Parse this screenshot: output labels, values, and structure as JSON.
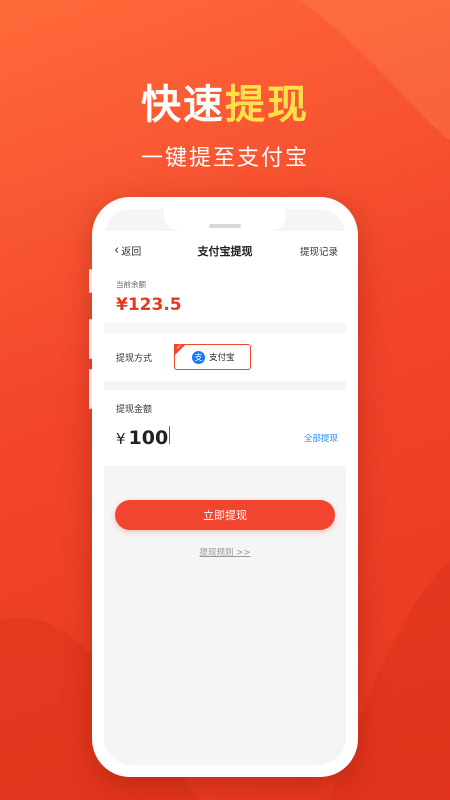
{
  "headline": {
    "part1": "快速",
    "part2": "提现"
  },
  "subline": "一键提至支付宝",
  "colors": {
    "accent": "#ffe04a",
    "brand": "#f2452b",
    "link": "#2f8cf0"
  },
  "nav": {
    "back_icon": "chevron-left-icon",
    "back_label": "返回",
    "title": "支付宝提现",
    "record_label": "提现记录"
  },
  "balance": {
    "label": "当前余额",
    "value": "¥123.5"
  },
  "method": {
    "label": "提现方式",
    "option_icon": "alipay-icon",
    "option_icon_glyph": "支",
    "option_name": "支付宝",
    "selected_mark": "✓"
  },
  "amount": {
    "label": "提现金额",
    "currency": "¥",
    "value": "100",
    "all_label": "全部提现"
  },
  "submit_label": "立即提现",
  "rules_label": "提现规则 >>"
}
